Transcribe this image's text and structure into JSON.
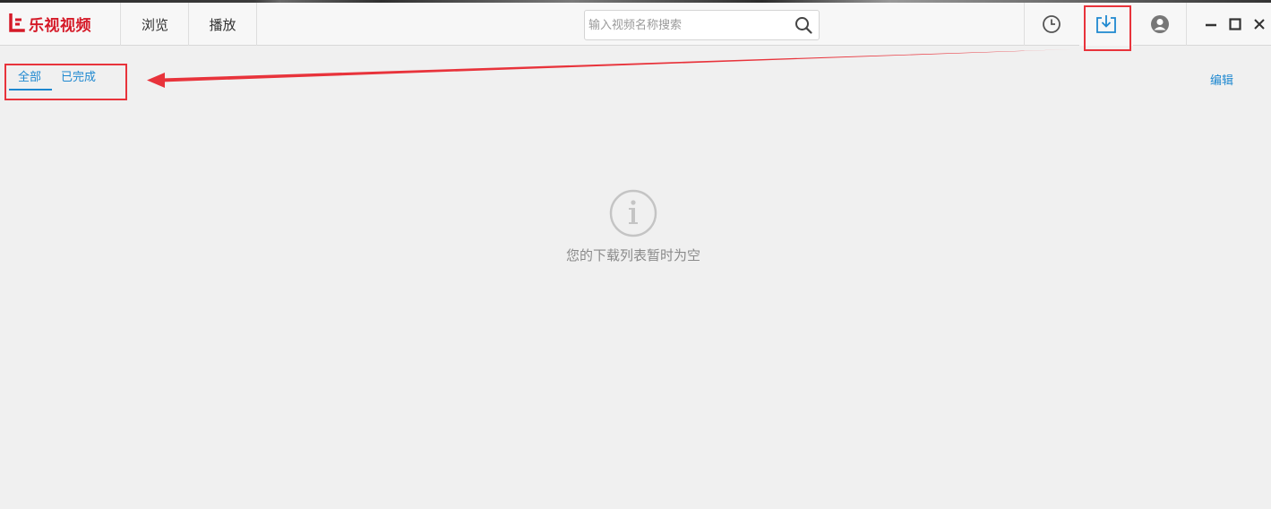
{
  "app": {
    "logo_text": "乐视视频",
    "brand_color": "#d51a28",
    "accent_color": "#1e88d0",
    "highlight_color": "#e8333b"
  },
  "nav": {
    "browse_label": "浏览",
    "play_label": "播放"
  },
  "search": {
    "placeholder": "输入视频名称搜索",
    "icon": "search-icon"
  },
  "toolbar": {
    "history_icon": "clock-icon",
    "download_icon": "download-icon",
    "user_icon": "user-icon"
  },
  "window_controls": {
    "minimize_icon": "minimize-icon",
    "maximize_icon": "maximize-icon",
    "close_icon": "close-icon"
  },
  "downloads": {
    "tabs": [
      {
        "label": "全部",
        "active": true
      },
      {
        "label": "已完成",
        "active": false
      }
    ],
    "edit_label": "编辑",
    "empty_message": "您的下载列表暂时为空",
    "empty_icon": "info-icon"
  }
}
